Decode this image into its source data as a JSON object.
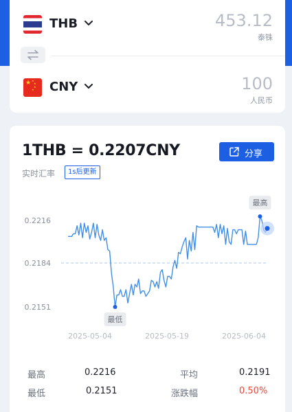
{
  "converter": {
    "from": {
      "code": "THB",
      "amount": "453.12",
      "unit": "泰铢"
    },
    "to": {
      "code": "CNY",
      "amount": "100",
      "unit": "人民币"
    },
    "swap_icon": "swap-arrows-icon"
  },
  "rate": {
    "title": "1THB = 0.2207CNY",
    "realtime_label": "实时汇率",
    "refresh_badge": "1s后更新",
    "share_label": "分享"
  },
  "chart_data": {
    "type": "line",
    "x_ticks": [
      "2025-05-04",
      "2025-05-19",
      "2025-06-04"
    ],
    "y_ticks": [
      "0.2216",
      "0.2184",
      "0.2151"
    ],
    "ylim": [
      0.2151,
      0.2216
    ],
    "reference_line": 0.2184,
    "series": [
      {
        "values": [
          0.2204,
          0.2204,
          0.2204,
          0.2206,
          0.2206,
          0.2212,
          0.2205,
          0.2214,
          0.2203,
          0.2214,
          0.2207,
          0.2212,
          0.2202,
          0.2207,
          0.2214,
          0.2203,
          0.2213,
          0.2205,
          0.2201,
          0.2209,
          0.2201,
          0.2203,
          0.2194,
          0.2193,
          0.2176,
          0.2166,
          0.2151,
          0.216,
          0.216,
          0.2164,
          0.2159,
          0.2159,
          0.2164,
          0.2154,
          0.2161,
          0.2168,
          0.216,
          0.2168,
          0.2166,
          0.2172,
          0.2161,
          0.2163,
          0.2163,
          0.2159,
          0.2161,
          0.2163,
          0.2171,
          0.217,
          0.2166,
          0.217,
          0.2165,
          0.2177,
          0.2179,
          0.2171,
          0.2166,
          0.2174,
          0.2174,
          0.2172,
          0.2181,
          0.2186,
          0.218,
          0.2192,
          0.2191,
          0.2196,
          0.22,
          0.2203,
          0.2187,
          0.2201,
          0.2193,
          0.2207,
          0.2194,
          0.2212,
          0.2211,
          0.2211,
          0.2211,
          0.2211,
          0.2211,
          0.2211,
          0.2211,
          0.2211,
          0.2211,
          0.2207,
          0.2213,
          0.2203,
          0.2213,
          0.2206,
          0.2212,
          0.2198,
          0.221,
          0.22,
          0.2198,
          0.2209,
          0.2209,
          0.2206,
          0.2209,
          0.2209,
          0.2209,
          0.2198,
          0.2208,
          0.2198,
          0.2198,
          0.2198,
          0.2198,
          0.2198,
          0.2198,
          0.2203,
          0.2219,
          0.2216,
          0.2209,
          0.2207,
          0.221
        ]
      }
    ],
    "max_label": "最高",
    "min_label": "最低",
    "max_value": 0.2216,
    "min_value": 0.2151
  },
  "stats": {
    "high_label": "最高",
    "high_value": "0.2216",
    "avg_label": "平均",
    "avg_value": "0.2191",
    "low_label": "最低",
    "low_value": "0.2151",
    "change_label": "涨跌幅",
    "change_value": "0.50%"
  },
  "colors": {
    "accent": "#1d5fe3",
    "line": "#3f8ee8",
    "change": "#e8473c"
  }
}
